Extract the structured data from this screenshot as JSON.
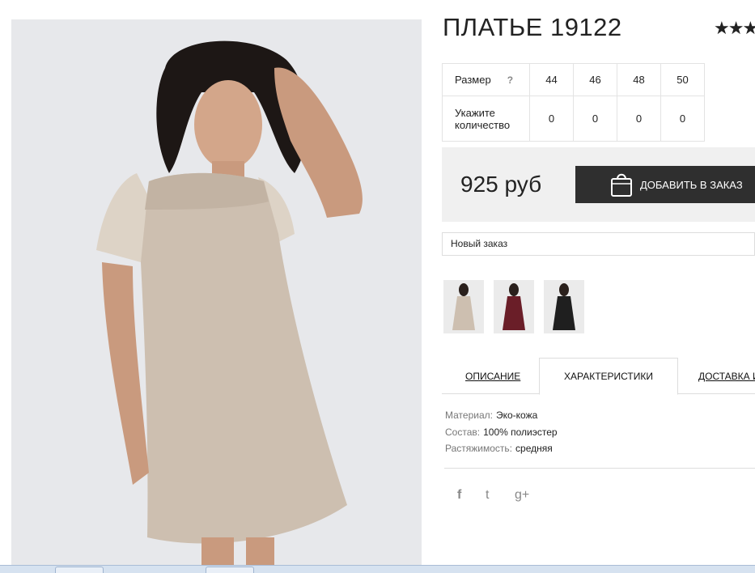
{
  "product": {
    "title": "ПЛАТЬЕ 19122",
    "rating_stars": "★★★"
  },
  "size_table": {
    "size_label": "Размер",
    "help_mark": "?",
    "sizes": [
      "44",
      "46",
      "48",
      "50"
    ],
    "quantity_label": "Укажите количество",
    "quantities": [
      "0",
      "0",
      "0",
      "0"
    ]
  },
  "order": {
    "price": "925 руб",
    "add_button_label": "ДОБАВИТЬ В ЗАКАЗ",
    "order_select_value": "Новый заказ"
  },
  "thumbnails": [
    {
      "name": "beige-dress-thumbnail",
      "dress_color": "#cdbfb0"
    },
    {
      "name": "burgundy-dress-thumbnail",
      "dress_color": "#6a1e28"
    },
    {
      "name": "black-dress-thumbnail",
      "dress_color": "#1f1f1f"
    }
  ],
  "tabs": {
    "description": "ОПИСАНИЕ",
    "characteristics": "ХАРАКТЕРИСТИКИ",
    "delivery": "ДОСТАВКА И"
  },
  "specs": [
    {
      "key": "Материал:",
      "value": "Эко-кожа"
    },
    {
      "key": "Состав:",
      "value": "100% полиэстер"
    },
    {
      "key": "Растяжимость:",
      "value": "средняя"
    }
  ],
  "social": {
    "facebook": "f",
    "twitter": "t",
    "google_plus": "g+"
  },
  "colors": {
    "button_bg": "#2f2f2f",
    "order_box_bg": "#f0f0f0",
    "dress_main": "#cdbfb0"
  }
}
